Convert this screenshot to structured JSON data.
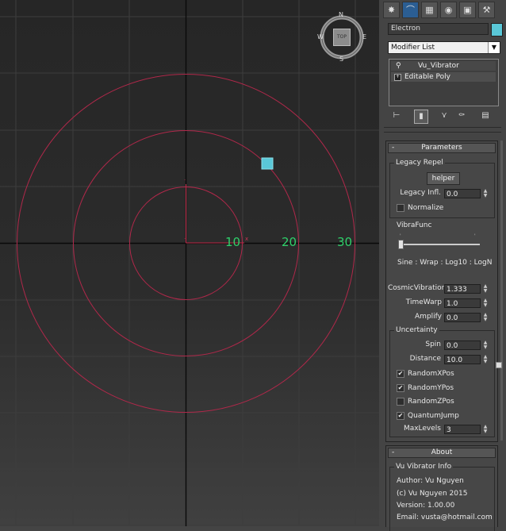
{
  "viewport": {
    "axis_labels": [
      "10",
      "20",
      "30"
    ],
    "viewcube": {
      "n": "N",
      "s": "S",
      "e": "E",
      "w": "W",
      "face": "TOP"
    }
  },
  "panel": {
    "tabs": [
      "create-tab",
      "modify-tab",
      "hierarchy-tab",
      "motion-tab",
      "display-tab",
      "utilities-tab"
    ],
    "object_name": "Electron",
    "object_color": "#5ac8d8",
    "modifier_list": "Modifier List",
    "stack": [
      "Vu_Vibrator",
      "Editable Poly"
    ],
    "parameters": {
      "title": "Parameters",
      "collapse_symbol": "-",
      "legacy_repel": {
        "title": "Legacy Repel",
        "helper_button": "helper",
        "legacy_infl_label": "Legacy Infl.",
        "legacy_infl_value": "0.0",
        "normalize_label": "Normalize",
        "normalize_checked": false
      },
      "vibrafunc": {
        "label": "VibraFunc",
        "modes": "Sine : Wrap : Log10 : LogN",
        "slider_value": 0
      },
      "cosmic_vibration_label": "CosmicVibration",
      "cosmic_vibration_value": "1.333",
      "timewarp_label": "TimeWarp",
      "timewarp_value": "1.0",
      "amplify_label": "Amplify",
      "amplify_value": "0.0",
      "uncertainty": {
        "title": "Uncertainty",
        "spin_label": "Spin",
        "spin_value": "0.0",
        "distance_label": "Distance",
        "distance_value": "10.0",
        "checks": [
          {
            "label": "RandomXPos",
            "checked": true,
            "mark": "✔"
          },
          {
            "label": "RandomYPos",
            "checked": true,
            "mark": "✔"
          },
          {
            "label": "RandomZPos",
            "checked": false,
            "mark": ""
          },
          {
            "label": "QuantumJump",
            "checked": true,
            "mark": "✔"
          }
        ],
        "max_levels_label": "MaxLevels",
        "max_levels_value": "3"
      }
    },
    "about": {
      "title": "About",
      "collapse_symbol": "-",
      "group_title": "Vu Vibrator Info",
      "author": "Author: Vu Nguyen",
      "copyright": "(c) Vu Nguyen 2015",
      "version": "Version: 1.00.00",
      "email": "Email: vusta@hotmail.com"
    }
  },
  "colors": {
    "grid": "#3d3d3d",
    "axis": "#0a0a0a",
    "circle": "#b0284a",
    "label_green": "#2fd06a",
    "selected_tab": "#2b5e93",
    "object_cyan": "#5ac8d8"
  }
}
